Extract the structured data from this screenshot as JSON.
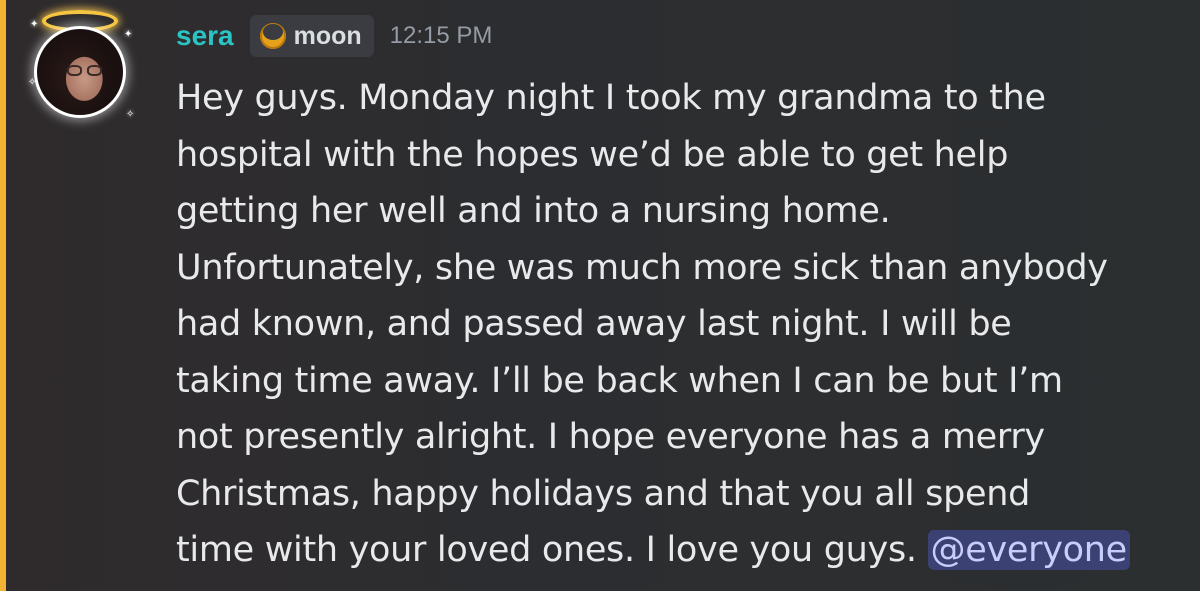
{
  "message": {
    "username": "sera",
    "role_tag": {
      "icon": "crescent-moon-icon",
      "label": "moon"
    },
    "timestamp": "12:15 PM",
    "lines": [
      "Hey guys. Monday night I took my grandma to the",
      "hospital with the hopes we’d be able to get help",
      "getting her well and into a nursing home.",
      "Unfortunately, she was much more sick than anybody",
      "had known, and passed away last night. I will be",
      "taking time away. I’ll be back when I can be but I’m",
      "not presently alright. I hope everyone has a merry",
      "Christmas, happy holidays and that you all spend"
    ],
    "last_line_text": "time with your loved ones. I love you guys. ",
    "mention": "@everyone"
  },
  "colors": {
    "username": "#2bc4c4",
    "mention_highlight_bar": "#f0b232",
    "mention_bg": "#5865f2"
  }
}
